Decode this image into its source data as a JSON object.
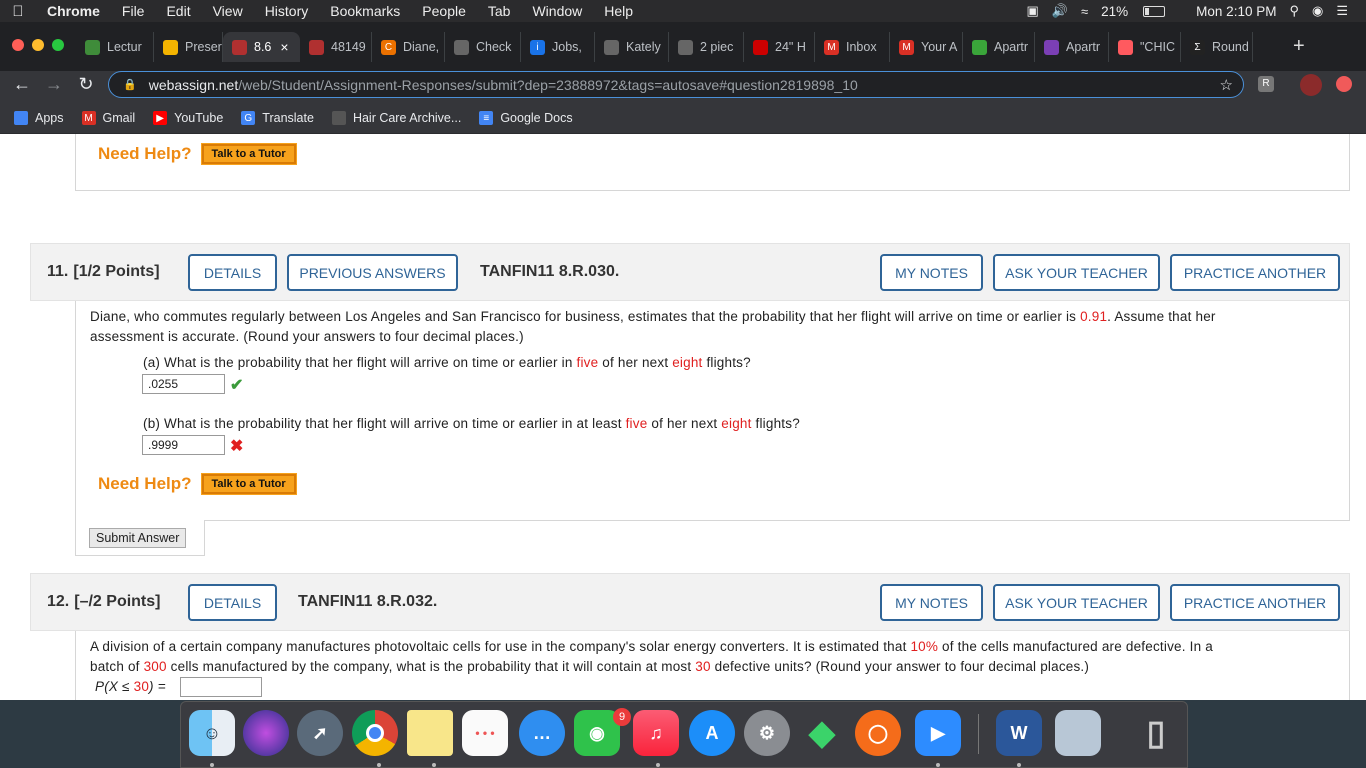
{
  "menubar": {
    "app": "Chrome",
    "items": [
      "File",
      "Edit",
      "View",
      "History",
      "Bookmarks",
      "People",
      "Tab",
      "Window",
      "Help"
    ],
    "battery": "21%",
    "clock": "Mon 2:10 PM"
  },
  "tabs": [
    {
      "label": "Lectur",
      "icon": "lecture-icon",
      "color": "#3f8c3a"
    },
    {
      "label": "Preser",
      "icon": "drive-icon",
      "color": "#f4b400"
    },
    {
      "label": "8.6",
      "icon": "webassign-icon",
      "color": "#b03030",
      "active": true,
      "close": "×"
    },
    {
      "label": "48149",
      "icon": "webassign-icon",
      "color": "#b03030"
    },
    {
      "label": "Diane,",
      "icon": "chegg-icon",
      "color": "#eb7100",
      "glyph": "C"
    },
    {
      "label": "Check",
      "icon": "globe-icon",
      "color": "#666"
    },
    {
      "label": "Jobs,",
      "icon": "info-icon",
      "color": "#1a73e8",
      "glyph": "i"
    },
    {
      "label": "Kately",
      "icon": "globe-icon",
      "color": "#666"
    },
    {
      "label": "2 piec",
      "icon": "globe-icon",
      "color": "#666"
    },
    {
      "label": "24\" H",
      "icon": "target-icon",
      "color": "#cc0000"
    },
    {
      "label": "Inbox",
      "icon": "gmail-icon",
      "color": "#d93025",
      "glyph": "M"
    },
    {
      "label": "Your A",
      "icon": "gmail-icon",
      "color": "#d93025",
      "glyph": "M"
    },
    {
      "label": "Apartr",
      "icon": "recycle-icon",
      "color": "#3aa53a"
    },
    {
      "label": "Apartr",
      "icon": "apartment-icon",
      "color": "#7b3fb5"
    },
    {
      "label": "\"CHIC",
      "icon": "airbnb-icon",
      "color": "#ff5a5f"
    },
    {
      "label": "Round",
      "icon": "sigma-icon",
      "color": "#222",
      "glyph": "Σ"
    }
  ],
  "address": {
    "host": "webassign.net",
    "path": "/web/Student/Assignment-Responses/submit?dep=23888972&tags=autosave#question2819898_10"
  },
  "bookmarks": [
    {
      "label": "Apps",
      "icon": "apps-grid-icon",
      "color": "#4285f4"
    },
    {
      "label": "Gmail",
      "icon": "gmail-icon",
      "color": "#d93025",
      "glyph": "M"
    },
    {
      "label": "YouTube",
      "icon": "youtube-icon",
      "color": "#ff0000",
      "glyph": "▶"
    },
    {
      "label": "Translate",
      "icon": "translate-icon",
      "color": "#4285f4",
      "glyph": "G"
    },
    {
      "label": "Hair Care Archive...",
      "icon": "globe-icon",
      "color": "#555"
    },
    {
      "label": "Google Docs",
      "icon": "docs-icon",
      "color": "#4285f4",
      "glyph": "≡"
    }
  ],
  "help": {
    "need_help": "Need Help?",
    "tutor": "Talk to a Tutor"
  },
  "q11": {
    "num": "11.",
    "points": "[1/2 Points]",
    "details": "DETAILS",
    "previous": "PREVIOUS ANSWERS",
    "code": "TANFIN11 8.R.030.",
    "my_notes": "MY NOTES",
    "ask": "ASK YOUR TEACHER",
    "practice": "PRACTICE ANOTHER",
    "intro_1": "Diane, who commutes regularly between Los Angeles and San Francisco for business, estimates that the probability that her flight will arrive on time or earlier is ",
    "prob": "0.91",
    "intro_2": ". Assume that her",
    "intro_3": "assessment is accurate. (Round your answers to four decimal places.)",
    "a_1": "(a) What is the probability that her flight will arrive on time or earlier in ",
    "a_five": "five",
    "a_2": " of her next ",
    "a_eight": "eight",
    "a_3": " flights?",
    "a_answer": ".0255",
    "a_mark": "✔",
    "b_1": "(b) What is the probability that her flight will arrive on time or earlier in at least ",
    "b_five": "five",
    "b_2": " of her next ",
    "b_eight": "eight",
    "b_3": " flights?",
    "b_answer": ".9999",
    "b_mark": "✖",
    "submit": "Submit Answer"
  },
  "q12": {
    "num": "12.",
    "points": "[–/2 Points]",
    "details": "DETAILS",
    "code": "TANFIN11 8.R.032.",
    "my_notes": "MY NOTES",
    "ask": "ASK YOUR TEACHER",
    "practice": "PRACTICE ANOTHER",
    "t1": "A division of a certain company manufactures photovoltaic cells for use in the company's solar energy converters. It is estimated that ",
    "pct": "10%",
    "t2": " of the cells manufactured are defective. In a",
    "t3": "batch of ",
    "n": "300",
    "t4": " cells manufactured by the company, what is the probability that it will contain at most ",
    "k": "30",
    "t5": " defective units? (Round your answer to four decimal places.)",
    "expr_1": "P(X ≤ ",
    "expr_k": "30",
    "expr_2": ") = ",
    "answer": ""
  },
  "dock": {
    "messages_badge": "9",
    "word_glyph": "W"
  }
}
